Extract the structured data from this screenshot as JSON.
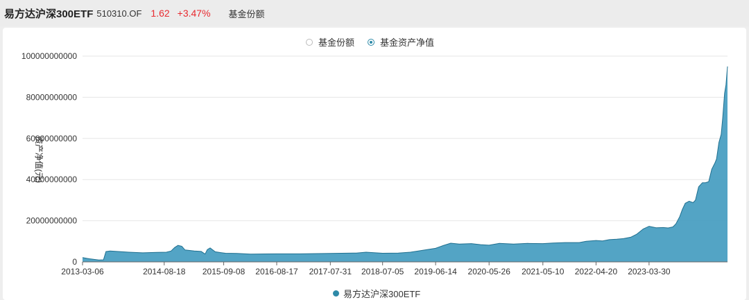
{
  "header": {
    "fund_name": "易方达沪深300ETF",
    "fund_code": "510310.OF",
    "price": "1.62",
    "change": "+3.47%",
    "tab": "基金份额"
  },
  "toggles": [
    {
      "label": "基金份额",
      "checked": false
    },
    {
      "label": "基金资产净值",
      "checked": true
    }
  ],
  "colors": {
    "series": "#2e8aa8",
    "area": "#4a9fc2",
    "price_up": "#e8292f"
  },
  "chart_data": {
    "type": "area",
    "ylabel": "资产净值(元)",
    "ylim": [
      0,
      100000000000
    ],
    "yticks": [
      "0",
      "20000000000",
      "40000000000",
      "60000000000",
      "80000000000",
      "100000000000"
    ],
    "ytick_values": [
      0,
      20000000000,
      40000000000,
      60000000000,
      80000000000,
      100000000000
    ],
    "xlim": [
      "2013-03-06",
      "2024-08-20"
    ],
    "xticks": [
      "2013-03-06",
      "2014-08-18",
      "2015-09-08",
      "2016-08-17",
      "2017-07-31",
      "2018-07-05",
      "2019-06-14",
      "2020-05-26",
      "2021-05-10",
      "2022-04-20",
      "2023-03-30"
    ],
    "grid": true,
    "legend": "bottom",
    "series": [
      {
        "name": "易方达沪深300ETF",
        "x": [
          "2013-03-06",
          "2013-04-20",
          "2013-05-20",
          "2013-06-20",
          "2013-07-20",
          "2013-08-05",
          "2013-09-01",
          "2013-11-01",
          "2014-01-01",
          "2014-04-01",
          "2014-07-01",
          "2014-09-01",
          "2014-10-01",
          "2014-10-25",
          "2014-11-15",
          "2014-12-10",
          "2014-12-31",
          "2015-03-01",
          "2015-04-15",
          "2015-05-10",
          "2015-05-25",
          "2015-06-12",
          "2015-07-15",
          "2015-08-20",
          "2015-09-20",
          "2015-12-01",
          "2016-03-01",
          "2016-08-17",
          "2017-01-15",
          "2017-07-31",
          "2018-01-15",
          "2018-03-20",
          "2018-07-05",
          "2018-10-15",
          "2019-01-01",
          "2019-03-01",
          "2019-04-20",
          "2019-06-14",
          "2019-08-01",
          "2019-09-20",
          "2019-11-15",
          "2020-02-01",
          "2020-04-01",
          "2020-05-26",
          "2020-08-01",
          "2020-11-01",
          "2021-02-01",
          "2021-05-10",
          "2021-07-15",
          "2021-10-01",
          "2022-01-01",
          "2022-02-15",
          "2022-04-20",
          "2022-06-01",
          "2022-07-15",
          "2022-09-01",
          "2022-10-15",
          "2022-12-01",
          "2023-01-10",
          "2023-02-20",
          "2023-03-30",
          "2023-05-15",
          "2023-06-30",
          "2023-08-01",
          "2023-09-01",
          "2023-09-20",
          "2023-10-15",
          "2023-11-01",
          "2023-11-20",
          "2023-12-15",
          "2024-01-10",
          "2024-01-25",
          "2024-02-15",
          "2024-03-10",
          "2024-03-30",
          "2024-04-20",
          "2024-05-10",
          "2024-05-30",
          "2024-06-10",
          "2024-06-25",
          "2024-07-10",
          "2024-07-20",
          "2024-08-01",
          "2024-08-10",
          "2024-08-20"
        ],
        "y": [
          2100000000,
          1500000000,
          1200000000,
          900000000,
          1000000000,
          5000000000,
          5300000000,
          5000000000,
          4700000000,
          4400000000,
          4600000000,
          4700000000,
          5300000000,
          7000000000,
          8000000000,
          7600000000,
          5800000000,
          5300000000,
          5100000000,
          3800000000,
          6000000000,
          6800000000,
          4900000000,
          4500000000,
          4200000000,
          4100000000,
          3800000000,
          3900000000,
          3900000000,
          4100000000,
          4300000000,
          4700000000,
          4200000000,
          4300000000,
          4700000000,
          5400000000,
          6000000000,
          6600000000,
          7900000000,
          9100000000,
          8700000000,
          8900000000,
          8400000000,
          8100000000,
          9000000000,
          8700000000,
          9000000000,
          8900000000,
          9200000000,
          9400000000,
          9400000000,
          10000000000,
          10400000000,
          10200000000,
          10800000000,
          11000000000,
          11300000000,
          12000000000,
          13500000000,
          16000000000,
          17300000000,
          16600000000,
          16700000000,
          16500000000,
          17000000000,
          18500000000,
          22000000000,
          25500000000,
          28500000000,
          29500000000,
          28800000000,
          30000000000,
          36500000000,
          38500000000,
          38500000000,
          39000000000,
          45000000000,
          48000000000,
          50000000000,
          58000000000,
          62000000000,
          70000000000,
          82000000000,
          86000000000,
          95000000000
        ]
      }
    ]
  }
}
